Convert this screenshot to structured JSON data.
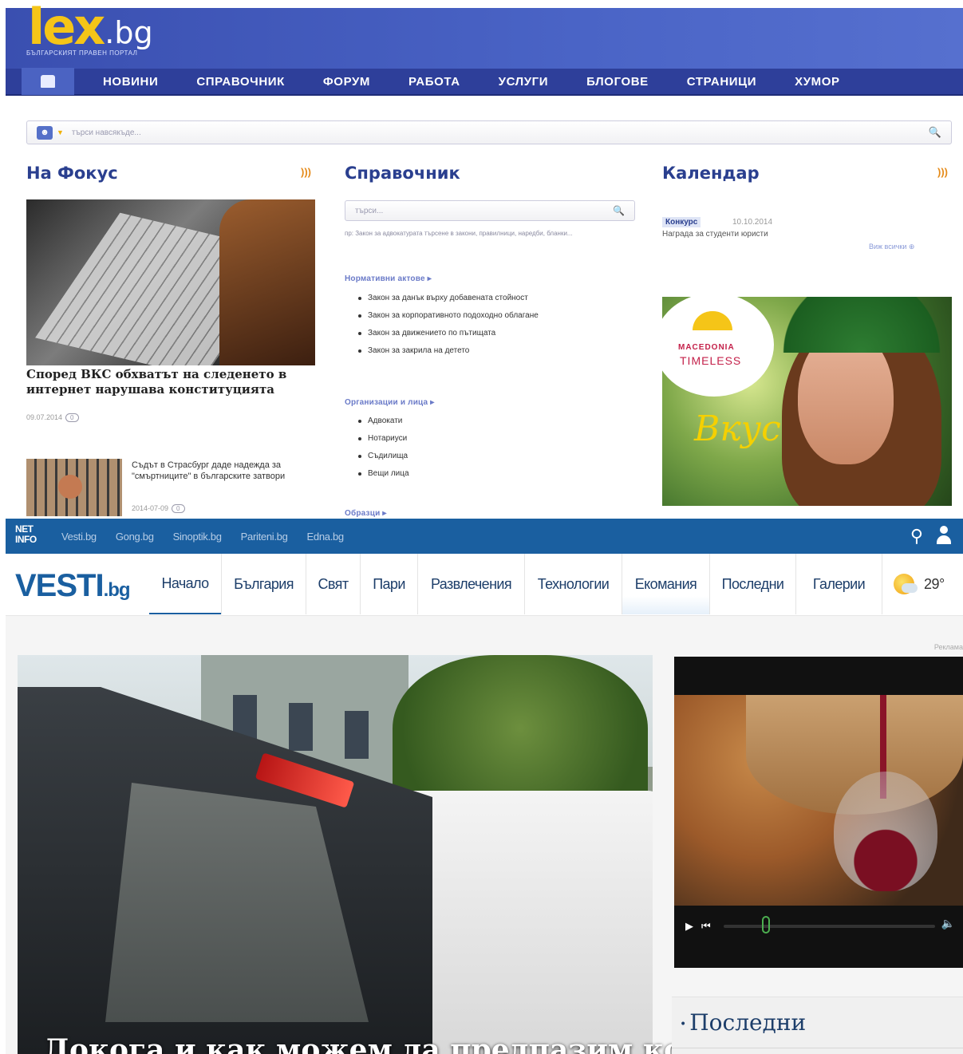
{
  "lex": {
    "logo": {
      "main": "lex",
      "tld": ".bg",
      "tagline": "БЪЛГАРСКИЯТ ПРАВЕН ПОРТАЛ"
    },
    "nav": [
      "НОВИНИ",
      "СПРАВОЧНИК",
      "ФОРУМ",
      "РАБОТА",
      "УСЛУГИ",
      "БЛОГОВЕ",
      "СТРАНИЦИ",
      "ХУМОР"
    ],
    "search": {
      "placeholder": "търси навсякъде..."
    },
    "focus": {
      "title": "На Фокус",
      "headline": "Според ВКС обхватът на следенето в интернет нарушава конституцията",
      "date": "09.07.2014",
      "comments": "0",
      "secondary": {
        "text": "Съдът в Страсбург даде надежда за \"смъртниците\" в българските затвори",
        "date": "2014-07-09",
        "comments": "0"
      }
    },
    "reference": {
      "title": "Справочник",
      "search_placeholder": "търси...",
      "hint": "пр: Закон за адвокатурата търсене в закони, правилници, наредби, бланки...",
      "sections": [
        {
          "label": "Нормативни актове",
          "items": [
            "Закон за данък върху добавената стойност",
            "Закон за корпоративното подоходно облагане",
            "Закон за движението по пътищата",
            "Закон за закрила на детето"
          ]
        },
        {
          "label": "Организации и лица",
          "items": [
            "Адвокати",
            "Нотариуси",
            "Съдилища",
            "Вещи лица"
          ]
        },
        {
          "label": "Образци",
          "items": []
        }
      ]
    },
    "calendar": {
      "title": "Календар",
      "tag": "Конкурс",
      "date": "10.10.2014",
      "text": "Награда за студенти юристи",
      "all_link": "Виж всички"
    },
    "ad": {
      "brand_line1": "MACEDONIA",
      "brand_line2": "TIMELESS",
      "script": "Вкус"
    }
  },
  "vesti": {
    "netinfo": {
      "logo": "NET INFO",
      "links": [
        "Vesti.bg",
        "Gong.bg",
        "Sinoptik.bg",
        "Pariteni.bg",
        "Edna.bg"
      ]
    },
    "logo": {
      "main": "VESTI",
      "tld": ".bg"
    },
    "tabs": [
      "Начало",
      "България",
      "Свят",
      "Пари",
      "Развлечения",
      "Технологии",
      "Екомания",
      "Последни",
      "Галерии"
    ],
    "active_tab": "Начало",
    "weather": {
      "temp": "29°"
    },
    "ad_label": "Реклама",
    "main_headline": "Докога и как можем да предпазим колите",
    "latest": {
      "title": "Последни"
    }
  },
  "colors": {
    "lex_blue": "#2e3f9a",
    "lex_yellow": "#f5c518",
    "vesti_blue": "#1a5fa0",
    "vesti_nav_text": "#1d3e6a"
  }
}
